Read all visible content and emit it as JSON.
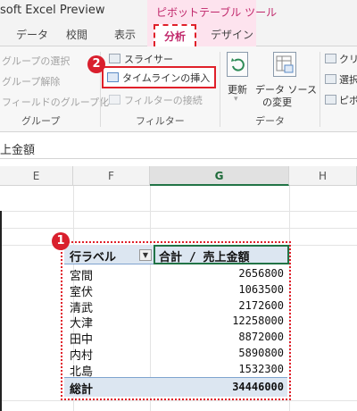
{
  "title_bar": {
    "app_title": "soft Excel Preview",
    "context_group": "ピボットテーブル ツール"
  },
  "tabs": [
    "データ",
    "校閲",
    "表示",
    "分析",
    "デザイン"
  ],
  "active_tab": "分析",
  "ribbon": {
    "group_items": [
      "グループの選択",
      "グループ解除",
      "フィールドのグループ化"
    ],
    "group_label": "グループ",
    "filter_items": [
      "スライサー",
      "タイムラインの挿入",
      "フィルターの接続"
    ],
    "filter_label": "フィルター",
    "refresh_label": "更新",
    "change_source_line1": "データ ソース",
    "change_source_line2": "の変更",
    "data_label": "データ",
    "clear_label": "クリ",
    "select_label": "選択",
    "move_label": "ピボ"
  },
  "badges": {
    "one": "1",
    "two": "2"
  },
  "namebox_text": "上金額",
  "columns": [
    "E",
    "F",
    "G",
    "H"
  ],
  "pivot": {
    "row_label_header": "行ラベル",
    "value_header": "合計 / 売上金額",
    "rows": [
      {
        "label": "宮間",
        "value": "2656800"
      },
      {
        "label": "室伏",
        "value": "1063500"
      },
      {
        "label": "清武",
        "value": "2172600"
      },
      {
        "label": "大津",
        "value": "12258000"
      },
      {
        "label": "田中",
        "value": "8872000"
      },
      {
        "label": "内村",
        "value": "5890800"
      },
      {
        "label": "北島",
        "value": "1532300"
      }
    ],
    "total_label": "総計",
    "total_value": "34446000"
  },
  "colors": {
    "accent_red": "#e0202a",
    "context_pink": "#fde3ee",
    "context_text": "#c0266a",
    "excel_green": "#217346",
    "pivot_blue": "#dce6f1"
  }
}
